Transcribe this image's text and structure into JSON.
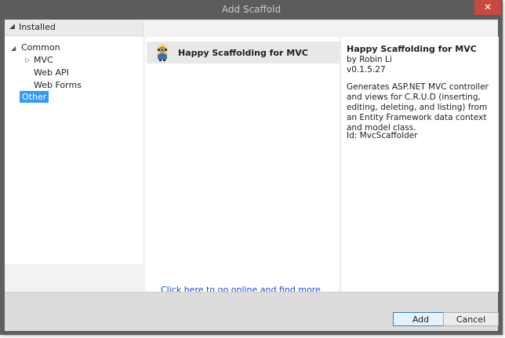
{
  "window": {
    "title": "Add Scaffold",
    "close_glyph": "✕"
  },
  "sidebar": {
    "header": {
      "label": "Installed",
      "expanded_glyph": "◢"
    },
    "tree": {
      "common": {
        "label": "Common",
        "glyph": "◢"
      },
      "mvc": {
        "label": "MVC",
        "glyph": "▷"
      },
      "webapi": {
        "label": "Web API"
      },
      "webforms": {
        "label": "Web Forms"
      },
      "other": {
        "label": "Other",
        "selected": true
      }
    }
  },
  "list": {
    "items": [
      {
        "label": "Happy Scaffolding for MVC",
        "icon": "minion-icon",
        "selected": true
      }
    ],
    "online_link": "Click here to go online and find more scaffolding extensions."
  },
  "details": {
    "title": "Happy Scaffolding for MVC",
    "author": "by Robin Li",
    "version": "v0.1.5.27",
    "description": "Generates ASP.NET MVC controller and views for C.R.U.D (inserting, editing, deleting, and listing) from an Entity Framework data context and model class.",
    "id": "Id: MvcScaffolder"
  },
  "buttons": {
    "add": "Add",
    "cancel": "Cancel"
  },
  "colors": {
    "selection": "#3399ff",
    "link": "#1a4bd6",
    "close": "#c7483f"
  }
}
